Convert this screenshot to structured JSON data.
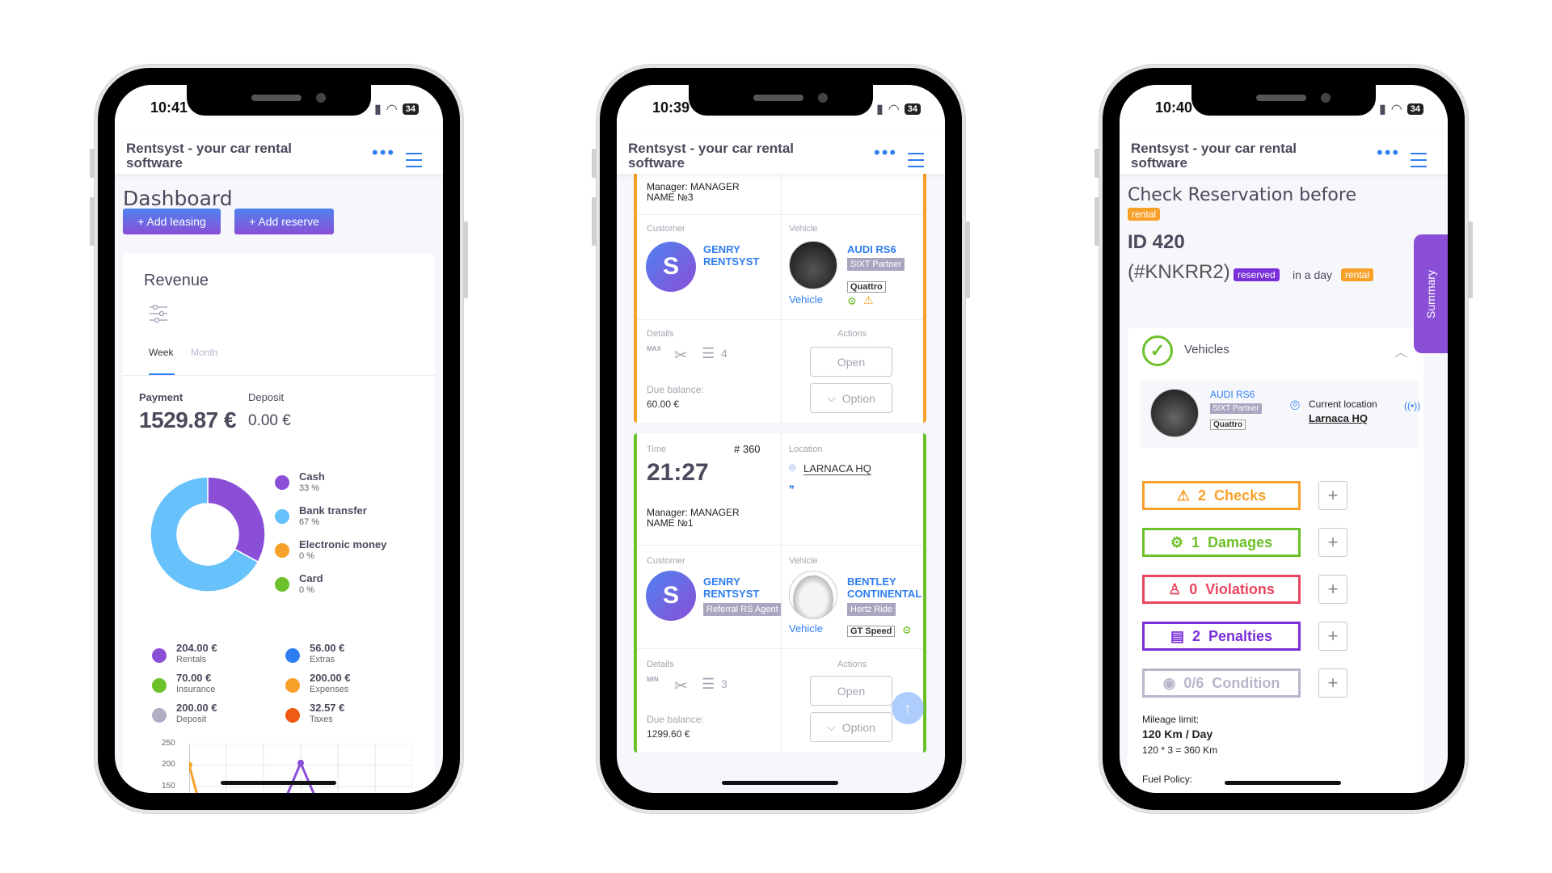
{
  "app_title": "Rentsyst - your car rental software",
  "colors": {
    "accent": "#2f7ef0",
    "purple": "#8a4fd6",
    "orange": "#f7a12a",
    "green": "#6cc02a",
    "red": "#e94560",
    "grey": "#b8b6cc"
  },
  "phone1": {
    "time": "10:41",
    "battery": "34",
    "page_title": "Dashboard",
    "add_leasing": "+ Add leasing",
    "add_reserve": "+ Add reserve",
    "revenue_title": "Revenue",
    "tabs": [
      "Week",
      "Month"
    ],
    "payment_label": "Payment",
    "payment_value": "1529.87 €",
    "deposit_label": "Deposit",
    "deposit_value": "0.00 €",
    "legend": [
      {
        "name": "Cash",
        "pct": "33 %",
        "color": "#8a4fd6"
      },
      {
        "name": "Bank transfer",
        "pct": "67 %",
        "color": "#67c1fa"
      },
      {
        "name": "Electronic money",
        "pct": "0 %",
        "color": "#f7a12a"
      },
      {
        "name": "Card",
        "pct": "0 %",
        "color": "#6cc02a"
      }
    ],
    "totals": [
      {
        "value": "204.00 €",
        "label": "Rentals",
        "color": "#8a4fd6"
      },
      {
        "value": "56.00 €",
        "label": "Extras",
        "color": "#2f7ef0"
      },
      {
        "value": "70.00 €",
        "label": "Insurance",
        "color": "#6cc02a"
      },
      {
        "value": "200.00 €",
        "label": "Expenses",
        "color": "#f7a12a"
      },
      {
        "value": "200.00 €",
        "label": "Deposit",
        "color": "#b0aec4"
      },
      {
        "value": "32.57 €",
        "label": "Taxes",
        "color": "#f05a12"
      }
    ]
  },
  "chart_data": [
    {
      "type": "pie",
      "categories": [
        "Cash",
        "Bank transfer",
        "Electronic money",
        "Card"
      ],
      "values": [
        33,
        67,
        0,
        0
      ]
    },
    {
      "type": "line",
      "y_ticks": [
        "250",
        "200",
        "150"
      ],
      "ylim": [
        150,
        250
      ],
      "grid": true,
      "series": [
        {
          "color": "#f7a12a",
          "points": [
            [
              0,
              200
            ],
            [
              0.3,
              150
            ]
          ]
        },
        {
          "color": "#8a4fd6",
          "points": [
            [
              2.5,
              150
            ],
            [
              3,
              205
            ],
            [
              3.5,
              150
            ]
          ]
        }
      ]
    }
  ],
  "phone2": {
    "time": "10:39",
    "battery": "34",
    "cards": [
      {
        "manager": "Manager: MANAGER NAME №3",
        "customer_label": "Customer",
        "customer": "GENRY RENTSYST",
        "vehicle_label": "Vehicle",
        "vehicle": "AUDI RS6",
        "vehicle_tag": "SIXT Partner",
        "vehicle_option": "Quattro",
        "vehicle_link": "Vehicle",
        "details_label": "Details",
        "details_count": "4",
        "details_badge": "MAX",
        "due_label": "Due balance:",
        "due": "60.00 €",
        "actions_label": "Actions",
        "open": "Open",
        "option": "Option"
      },
      {
        "time_label": "Time",
        "number": "# 360",
        "time": "21:27",
        "location_label": "Location",
        "location": "LARNACA HQ",
        "manager": "Manager: MANAGER NAME №1",
        "customer_label": "Customer",
        "customer": "GENRY RENTSYST",
        "customer_tag": "Referral RS Agent",
        "vehicle_label": "Vehicle",
        "vehicle": "BENTLEY CONTINENTAL",
        "vehicle_tag": "Hertz Ride",
        "vehicle_option": "GT Speed",
        "vehicle_link": "Vehicle",
        "details_label": "Details",
        "details_count": "3",
        "details_badge": "MIN",
        "due_label": "Due balance:",
        "due": "1299.60 €",
        "actions_label": "Actions",
        "open": "Open",
        "option": "Option"
      }
    ]
  },
  "phone3": {
    "time": "10:40",
    "battery": "34",
    "title": "Check Reservation before",
    "title_badge": "rental",
    "id": "ID 420",
    "code": "(#KNKRR2)",
    "status_badge": "reserved",
    "in_a_day": "in a day",
    "rental_badge": "rental",
    "summary_tab": "Summary",
    "vehicles_label": "Vehicles",
    "vehicle": {
      "name": "AUDI RS6",
      "tag": "SIXT Partner",
      "option": "Quattro",
      "location_label": "Current location",
      "location": "Larnaca HQ"
    },
    "stats": [
      {
        "count": "2",
        "label": "Checks",
        "color": "#f7a12a",
        "icon": "warning-icon"
      },
      {
        "count": "1",
        "label": "Damages",
        "color": "#6cc02a",
        "icon": "car-wrench-icon"
      },
      {
        "count": "0",
        "label": "Violations",
        "color": "#e94560",
        "icon": "officer-icon"
      },
      {
        "count": "2",
        "label": "Penalties",
        "color": "#7a2fd8",
        "icon": "clipboard-icon"
      },
      {
        "count": "0/6",
        "label": "Condition",
        "color": "#b8b6cc",
        "icon": "camera-icon"
      }
    ],
    "mileage_label": "Mileage limit:",
    "mileage_value": "120 Km / Day",
    "mileage_calc": "120 * 3 = 360 Km",
    "fuel_label": "Fuel Policy:"
  }
}
